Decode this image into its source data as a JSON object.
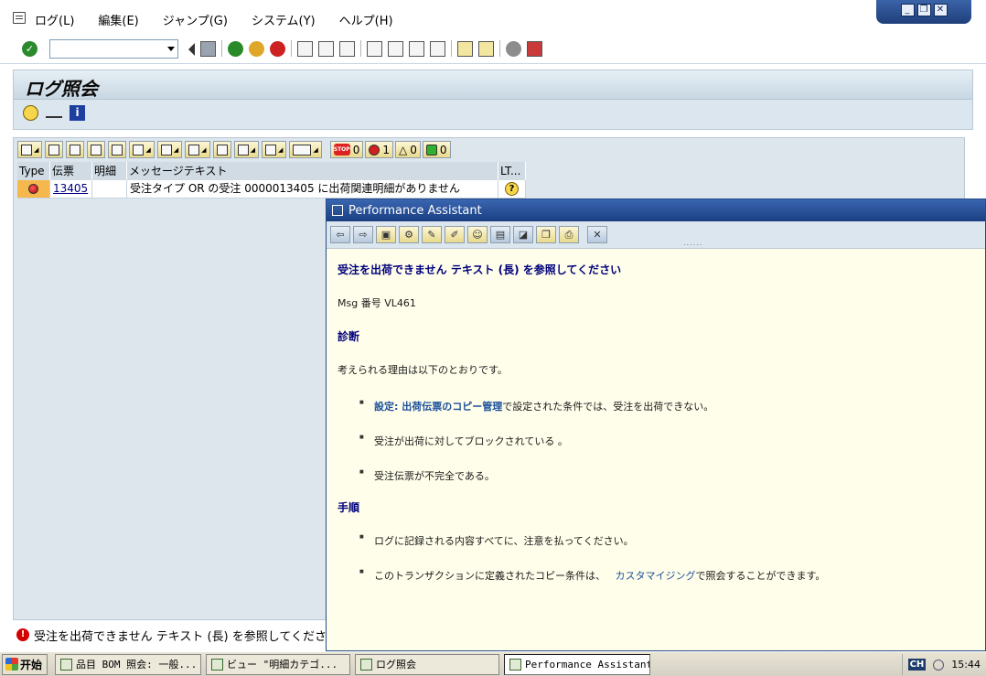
{
  "menu": {
    "items": [
      "ログ(L)",
      "編集(E)",
      "ジャンプ(G)",
      "システム(Y)",
      "ヘルプ(H)"
    ]
  },
  "toolbar": {
    "command_value": ""
  },
  "page": {
    "title": "ログ照会"
  },
  "alv": {
    "counts": {
      "stop": "0",
      "error": "1",
      "warning": "0",
      "success": "0"
    },
    "columns": [
      "Type",
      "伝票",
      "明細",
      "メッセージテキスト",
      "LT..."
    ],
    "rows": [
      {
        "type": "error",
        "document": "13405",
        "item": "",
        "message": "受注タイプ OR の受注 0000013405 に出荷関連明細がありません",
        "lt": "?"
      }
    ]
  },
  "status": {
    "message": "受注を出荷できません テキスト (長) を参照してください"
  },
  "assistant": {
    "window_title": "Performance Assistant",
    "heading": "受注を出荷できません テキスト (長) を参照してください",
    "msg_number": "Msg 番号 VL461",
    "diagnosis_title": "診断",
    "diagnosis_text": "考えられる理由は以下のとおりです。",
    "reasons": {
      "r1_link": "設定: 出荷伝票のコピー管理",
      "r1_rest": "で設定された条件では、受注を出荷できない。",
      "r2": "受注が出荷に対してブロックされている 。",
      "r3": "受注伝票が不完全である。"
    },
    "procedure_title": "手順",
    "steps": {
      "s1": "ログに記録される内容すべてに、注意を払ってください。",
      "s2_pre": "このトランザクションに定義されたコピー条件は、",
      "s2_link": "カスタマイジング",
      "s2_post": "で照会することができます。"
    }
  },
  "taskbar": {
    "start": "开始",
    "tasks": [
      "品目 BOM 照会: 一般...",
      "ビュー \"明細カテゴ...",
      "ログ照会",
      "Performance Assistant"
    ],
    "tray": [
      "CH",
      "15:44"
    ]
  },
  "colors": {
    "title_band": "#dce6ee",
    "assistant_bg": "#fffeea",
    "error_red": "#d40000",
    "heading_blue": "#00007c",
    "link_blue": "#1b4f9c"
  }
}
